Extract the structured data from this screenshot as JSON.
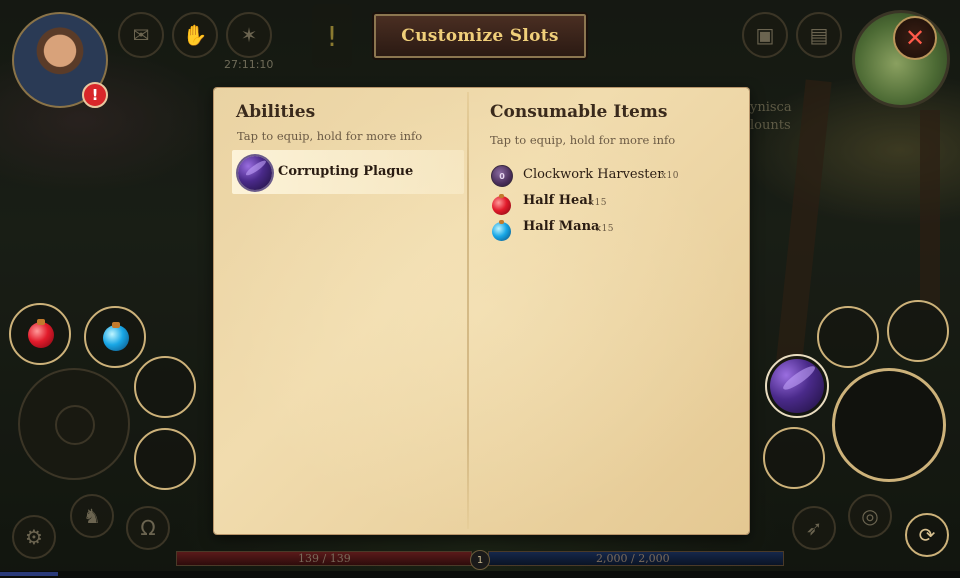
{
  "window": {
    "title": "Customize Slots"
  },
  "hud": {
    "timer": "27:11:10",
    "alert_glyph": "!",
    "close_glyph": "✕",
    "hp_text": "139 / 139",
    "mana_text": "2,000 / 2,000",
    "level": "1",
    "xp_fraction": 0.06,
    "background_label_1": "ynisca",
    "background_label_2": "lounts"
  },
  "abilities": {
    "title": "Abilities",
    "subtitle": "Tap to equip, hold for more info",
    "items": [
      {
        "name": "Corrupting Plague",
        "icon": "corrupting-plague-icon"
      }
    ]
  },
  "consumables": {
    "title": "Consumable Items",
    "subtitle": "Tap to equip, hold for more info",
    "items": [
      {
        "name": "Clockwork Harvester",
        "qty": "x10",
        "icon": "clockwork-harvester-icon",
        "badge": "0"
      },
      {
        "name": "Half Heal",
        "qty": "x15",
        "icon": "red-potion-icon"
      },
      {
        "name": "Half Mana",
        "qty": "x15",
        "icon": "blue-potion-icon"
      }
    ]
  },
  "colors": {
    "title_text": "#f0cf7a",
    "parchment": "#ead3a3",
    "hp_bar": "#5a1a1a",
    "mana_bar": "#15274a",
    "close_x": "#ff5a4a"
  }
}
